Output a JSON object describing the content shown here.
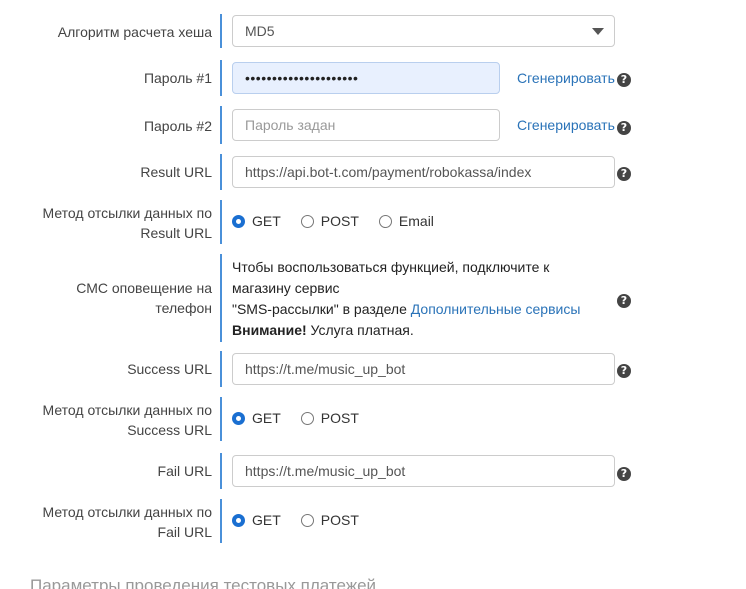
{
  "hash": {
    "label": "Алгоритм расчета хеша",
    "value": "MD5"
  },
  "password1": {
    "label": "Пароль #1",
    "value": "•••••••••••••••••••••",
    "generate": "Сгенерировать"
  },
  "password2": {
    "label": "Пароль #2",
    "placeholder": "Пароль задан",
    "generate": "Сгенерировать"
  },
  "result_url": {
    "label": "Result URL",
    "value": "https://api.bot-t.com/payment/robokassa/index"
  },
  "result_method": {
    "label_line1": "Метод отсылки данных по",
    "label_line2": "Result URL",
    "options": [
      "GET",
      "POST",
      "Email"
    ],
    "selected": "GET"
  },
  "sms": {
    "label_line1": "СМС оповещение на",
    "label_line2": "телефон",
    "text_line1": "Чтобы воспользоваться функцией, подключите к",
    "text_line2": "магазину сервис",
    "text_line3_pre": "\"SMS-рассылки\" в разделе ",
    "text_line3_link": "Дополнительные сервисы",
    "text_line4_bold": "Внимание!",
    "text_line4_rest": " Услуга платная."
  },
  "success_url": {
    "label": "Success URL",
    "value": "https://t.me/music_up_bot"
  },
  "success_method": {
    "label_line1": "Метод отсылки данных по",
    "label_line2": "Success URL",
    "options": [
      "GET",
      "POST"
    ],
    "selected": "GET"
  },
  "fail_url": {
    "label": "Fail URL",
    "value": "https://t.me/music_up_bot"
  },
  "fail_method": {
    "label_line1": "Метод отсылки данных по",
    "label_line2": "Fail URL",
    "options": [
      "GET",
      "POST"
    ],
    "selected": "GET"
  },
  "section_title": "Параметры проведения тестовых платежей",
  "help_glyph": "?",
  "colors": {
    "accent": "#4a90d9",
    "link": "#2a73b8",
    "radio": "#1a6fd1",
    "filled_bg": "#e8f0fe"
  }
}
